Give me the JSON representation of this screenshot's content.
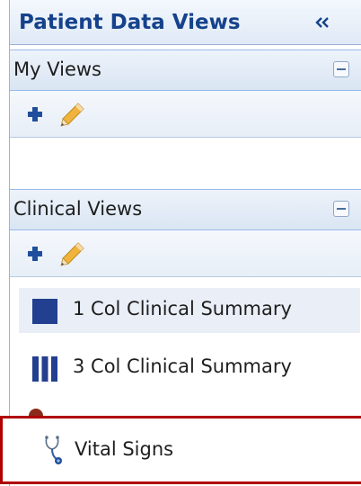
{
  "panel": {
    "title": "Patient Data Views"
  },
  "my_views": {
    "title": "My Views"
  },
  "clinical_views": {
    "title": "Clinical Views",
    "items": [
      {
        "label": "1 Col Clinical Summary",
        "icon": "one-column-layout-icon"
      },
      {
        "label": "3 Col Clinical Summary",
        "icon": "three-column-layout-icon"
      }
    ]
  },
  "highlighted_item": {
    "label": "Vital Signs",
    "icon": "stethoscope-icon"
  },
  "colors": {
    "title": "#15428b",
    "accent_icon": "#1f3b8c",
    "highlight_border": "#b00000"
  }
}
